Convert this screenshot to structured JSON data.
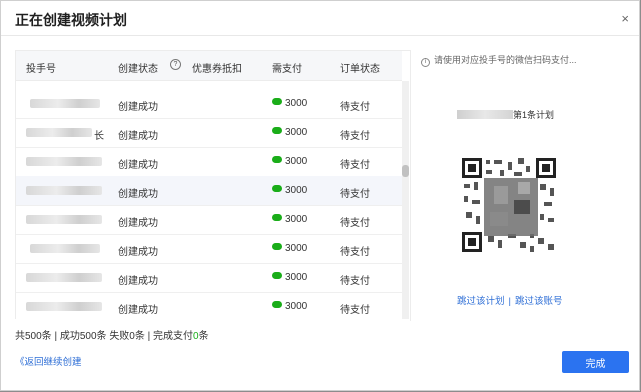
{
  "dialog": {
    "title": "正在创建视频计划",
    "close_glyph": "×"
  },
  "table": {
    "headers": [
      "投手号",
      "创建状态",
      "优惠券抵扣",
      "需支付",
      "订单状态"
    ],
    "help_glyph": "?",
    "rows": [
      {
        "name": "",
        "status": "创建成功",
        "amount": "3000",
        "order": "待支付"
      },
      {
        "name": "长",
        "status": "创建成功",
        "amount": "3000",
        "order": "待支付"
      },
      {
        "name": "",
        "status": "创建成功",
        "amount": "3000",
        "order": "待支付"
      },
      {
        "name": "",
        "status": "创建成功",
        "amount": "3000",
        "order": "待支付"
      },
      {
        "name": "",
        "status": "创建成功",
        "amount": "3000",
        "order": "待支付"
      },
      {
        "name": "",
        "status": "创建成功",
        "amount": "3000",
        "order": "待支付"
      },
      {
        "name": "",
        "status": "创建成功",
        "amount": "3000",
        "order": "待支付"
      },
      {
        "name": "",
        "status": "创建成功",
        "amount": "3000",
        "order": "待支付"
      }
    ]
  },
  "summary": {
    "total": "共500条",
    "sep": " | ",
    "success": "成功500条",
    "failed": "失败0条",
    "paid_prefix": "完成支付",
    "paid_count": "0",
    "paid_suffix": "条"
  },
  "back_link": "《返回继续创建",
  "right_panel": {
    "info_glyph": "i",
    "notice": "请使用对应投手号的微信扫码支付...",
    "plan_suffix": "第1条计划",
    "skip_plan": "跳过该计划",
    "skip_sep": "|",
    "skip_account": "跳过该账号"
  },
  "footer": {
    "done_label": "完成"
  },
  "colors": {
    "primary": "#2b73f0",
    "wechat_green": "#1aad19",
    "link": "#2f6fd6"
  },
  "icons": {
    "close": "close-icon",
    "help": "help-circle-icon",
    "info": "info-circle-icon",
    "wechat_pay": "wechat-pay-icon"
  }
}
